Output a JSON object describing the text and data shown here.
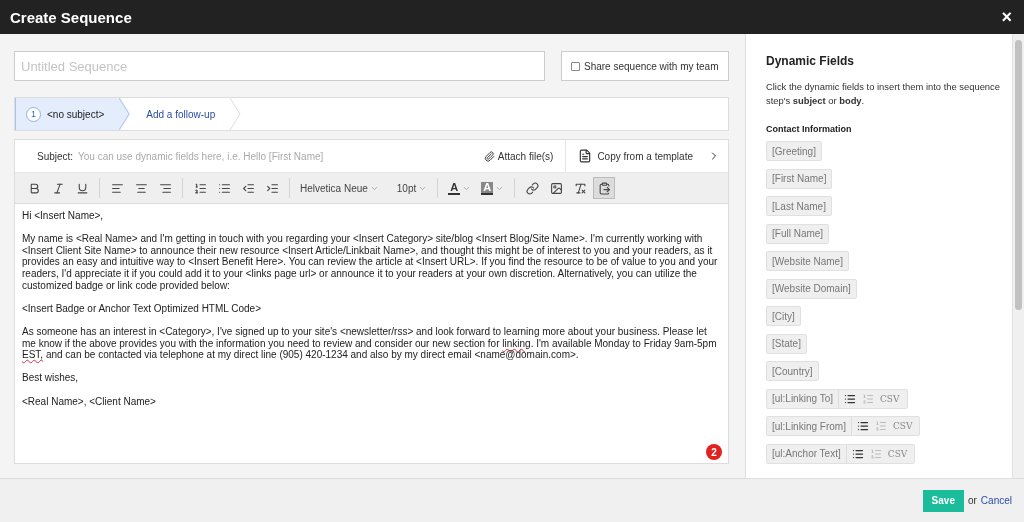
{
  "window": {
    "title": "Create Sequence",
    "close": "×"
  },
  "sequence_name": {
    "placeholder": "Untitled Sequence"
  },
  "share": {
    "label": "Share sequence with my team",
    "checked": false
  },
  "steps": [
    {
      "number": "1",
      "label": "<no subject>",
      "selected": true
    },
    {
      "label": "Add a follow-up",
      "selected": false
    }
  ],
  "subject": {
    "label": "Subject:",
    "placeholder": "You can use dynamic fields here, i.e. Hello [First Name]",
    "attach": "Attach file(s)",
    "template": "Copy from a template"
  },
  "toolbar": {
    "font": "Helvetica Neue",
    "size": "10pt",
    "text_color": "A",
    "background_color": "A",
    "paste_active": true
  },
  "body": [
    {
      "segments": [
        {
          "text": "Hi <Insert Name>,",
          "misspelled": false
        }
      ]
    },
    {
      "segments": [
        {
          "text": "My name is <Real Name> and I'm getting in touch with you regarding your <Insert Category> site/blog <Insert Blog/Site Name>. I'm currently working with <Insert Client Site Name> to announce their new resource <Insert Article/Linkbait Name>, and thought this might be of interest to you and your readers, as it provides an easy and intuitive way to <Insert Benefit Here>. You can review the article at <Insert URL>. If you find the resource to be of value to you and your readers, I'd appreciate it if you could add it to your <links page url> or announce it to your readers at your own discretion.  Alternatively, you can utilize the customized badge or link code provided below:",
          "misspelled": false
        }
      ]
    },
    {
      "segments": [
        {
          "text": "<Insert Badge or Anchor Text Optimized HTML Code>",
          "misspelled": false
        }
      ]
    },
    {
      "segments": [
        {
          "text": "As someone has an interest in <Category>, I've signed up to your site's <newsletter/rss> and look forward to learning more about your business. Please let me know if the above provides you with the information you need to review and consider our new section for ",
          "misspelled": false
        },
        {
          "text": "linking",
          "misspelled": true
        },
        {
          "text": ". I'm available Monday to Friday 9am-5pm ",
          "misspelled": false
        },
        {
          "text": "EST,",
          "misspelled": true
        },
        {
          "text": " and can be contacted via telephone at my direct line (905) 420-1234 and also by my direct email <name@domain.com>.",
          "misspelled": false
        }
      ]
    },
    {
      "segments": [
        {
          "text": "Best wishes,",
          "misspelled": false
        }
      ]
    },
    {
      "segments": [
        {
          "text": "<Real Name>, <Client Name>",
          "misspelled": false
        }
      ]
    }
  ],
  "notification_badge": "2",
  "dynamic_fields": {
    "title": "Dynamic Fields",
    "description": "Click the dynamic fields to insert them into the sequence step's **subject** or **body**.",
    "section": "Contact Information",
    "fields": [
      {
        "kind": "simple",
        "label": "[Greeting]"
      },
      {
        "kind": "simple",
        "label": "[First Name]"
      },
      {
        "kind": "simple",
        "label": "[Last Name]"
      },
      {
        "kind": "simple",
        "label": "[Full Name]"
      },
      {
        "kind": "simple",
        "label": "[Website Name]"
      },
      {
        "kind": "simple",
        "label": "[Website Domain]"
      },
      {
        "kind": "simple",
        "label": "[City]"
      },
      {
        "kind": "simple",
        "label": "[State]"
      },
      {
        "kind": "simple",
        "label": "[Country]"
      },
      {
        "kind": "list",
        "label": "[ul:Linking To]",
        "options": [
          {
            "kind": "bullets",
            "selected": true
          },
          {
            "kind": "numbered",
            "selected": false
          },
          {
            "kind": "csv",
            "label": "CSV",
            "selected": false
          }
        ]
      },
      {
        "kind": "list",
        "label": "[ul:Linking From]",
        "options": [
          {
            "kind": "bullets",
            "selected": true
          },
          {
            "kind": "numbered",
            "selected": false
          },
          {
            "kind": "csv",
            "label": "CSV",
            "selected": false
          }
        ]
      },
      {
        "kind": "list",
        "label": "[ul:Anchor Text]",
        "options": [
          {
            "kind": "bullets",
            "selected": true
          },
          {
            "kind": "numbered",
            "selected": false
          },
          {
            "kind": "csv",
            "label": "CSV",
            "selected": false
          }
        ]
      }
    ]
  },
  "footer": {
    "save": "Save",
    "or": "or",
    "cancel": "Cancel"
  }
}
